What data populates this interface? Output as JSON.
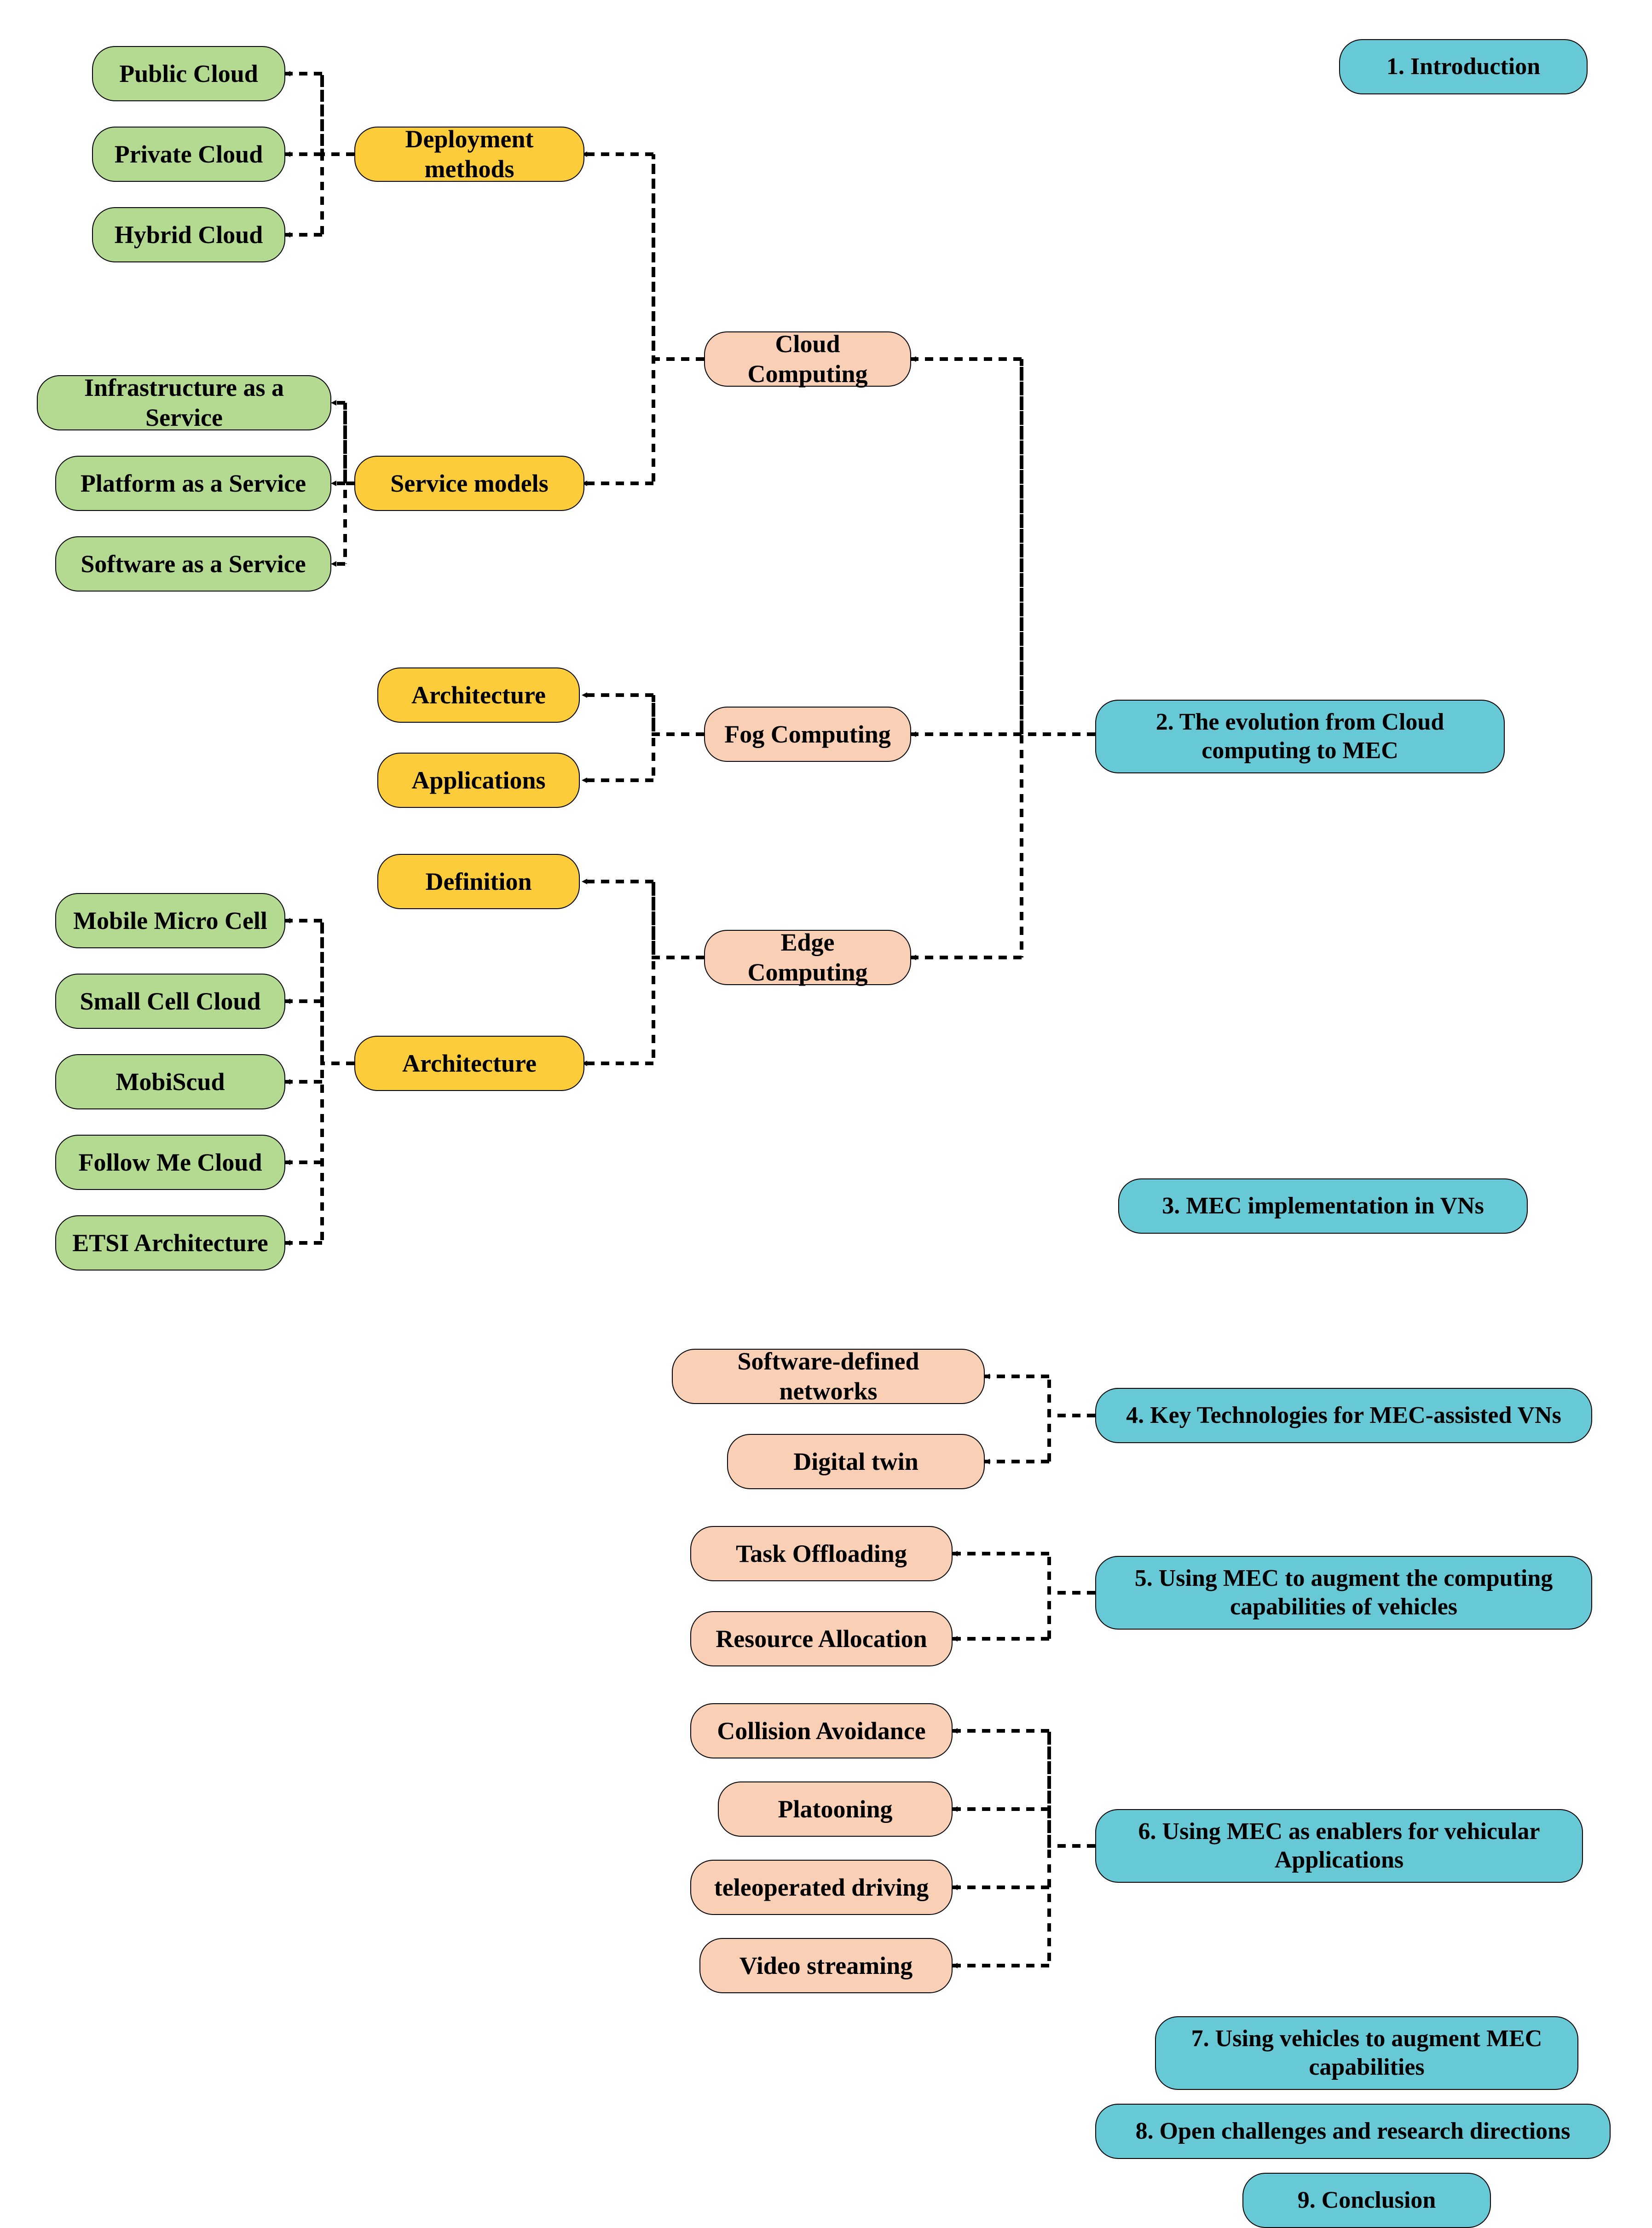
{
  "colors": {
    "blue": "#67c8d6",
    "peach": "#f9cfb5",
    "yellow": "#fccc3a",
    "green": "#b4d990"
  },
  "sections": {
    "s1": "1. Introduction",
    "s2": "2. The evolution from Cloud computing to MEC",
    "s3": "3. MEC implementation in VNs",
    "s4": "4. Key Technologies for MEC-assisted VNs",
    "s5": "5. Using MEC to augment the computing capabilities of vehicles",
    "s6": "6. Using MEC as enablers for vehicular Applications",
    "s7": "7. Using vehicles to augment MEC capabilities",
    "s8": "8. Open challenges and research directions",
    "s9": "9. Conclusion"
  },
  "s2_children": {
    "cloud": "Cloud Computing",
    "fog": "Fog Computing",
    "edge": "Edge Computing"
  },
  "cloud_children": {
    "deploy": "Deployment methods",
    "service": "Service models"
  },
  "deploy_children": {
    "public": "Public Cloud",
    "private": "Private Cloud",
    "hybrid": "Hybrid Cloud"
  },
  "service_children": {
    "iaas": "Infrastructure as a Service",
    "paas": "Platform as a Service",
    "saas": "Software as a Service"
  },
  "fog_children": {
    "arch": "Architecture",
    "apps": "Applications"
  },
  "edge_children": {
    "def": "Definition",
    "arch": "Architecture"
  },
  "edge_arch_children": {
    "mmc": "Mobile Micro Cell",
    "scc": "Small Cell Cloud",
    "mobi": "MobiScud",
    "fmc": "Follow Me Cloud",
    "etsi": "ETSI Architecture"
  },
  "s4_children": {
    "sdn": "Software-defined networks",
    "dt": "Digital twin"
  },
  "s5_children": {
    "task": "Task Offloading",
    "res": "Resource Allocation"
  },
  "s6_children": {
    "col": "Collision Avoidance",
    "plat": "Platooning",
    "tele": "teleoperated driving",
    "vid": "Video streaming"
  }
}
